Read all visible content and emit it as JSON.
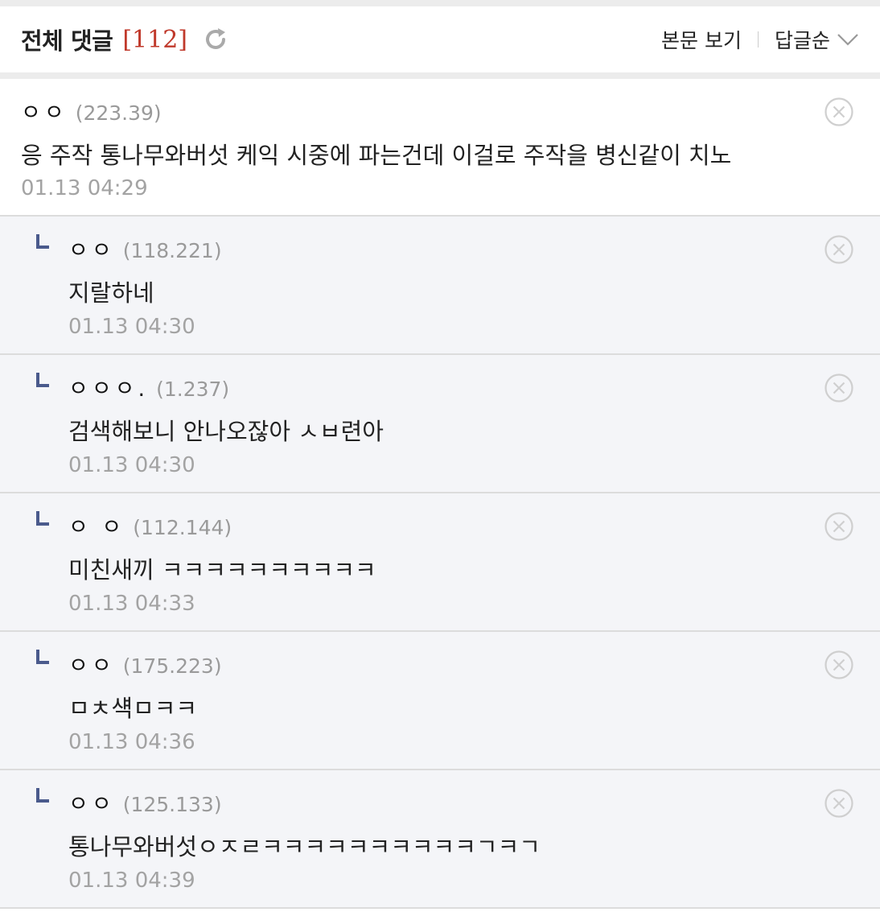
{
  "header": {
    "title": "전체 댓글",
    "count": "[112]",
    "refresh_icon": "refresh-icon",
    "view_post_label": "본문 보기",
    "sort_label": "답글순",
    "sort_icon": "chevron-down-icon"
  },
  "comments": [
    {
      "nick": "ㅇㅇ",
      "ip": "(223.39)",
      "text": "응 주작 통나무와버섯 케익 시중에 파는건데 이걸로 주작을 병신같이 치노",
      "date": "01.13 04:29"
    },
    {
      "nick": "ㅇㅇ",
      "ip": "(118.221)",
      "text": "지랄하네",
      "date": "01.13 04:30"
    },
    {
      "nick": "ㅇㅇㅇ.",
      "ip": "(1.237)",
      "text": "검색해보니 안나오잖아 ㅅㅂ련아",
      "date": "01.13 04:30"
    },
    {
      "nick": "ㅇ ㅇ",
      "ip": "(112.144)",
      "text": "미친새끼 ㅋㅋㅋㅋㅋㅋㅋㅋㅋㅋ",
      "date": "01.13 04:33"
    },
    {
      "nick": "ㅇㅇ",
      "ip": "(175.223)",
      "text": "ㅁㅊ섁ㅁㅋㅋ",
      "date": "01.13 04:36"
    },
    {
      "nick": "ㅇㅇ",
      "ip": "(125.133)",
      "text": "통나무와버섯ㅇㅈㄹㅋㅋㅋㅋㅋㅋㅋㅋㅋㅋㄱㅋㄱ",
      "date": "01.13 04:39"
    }
  ],
  "colors": {
    "count": "#c0392b",
    "reply_bg": "#f4f5f8",
    "reply_mark": "#4a5a8c",
    "muted": "#a3a3a3"
  },
  "icons": {
    "delete": "close-circle-icon",
    "reply": "reply-arrow-icon"
  }
}
